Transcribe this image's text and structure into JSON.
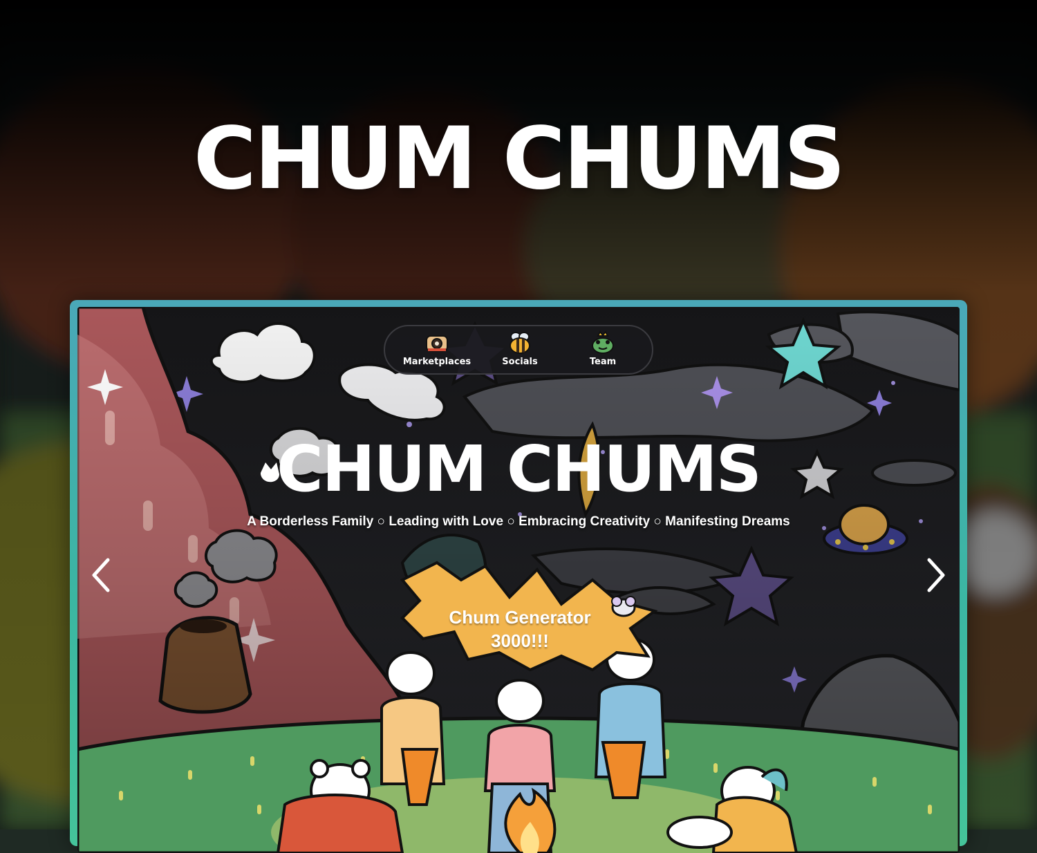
{
  "page": {
    "hero_title": "CHUM CHUMS"
  },
  "nav": {
    "items": [
      {
        "label": "Marketplaces",
        "icon": "camera-critter-icon"
      },
      {
        "label": "Socials",
        "icon": "bee-icon"
      },
      {
        "label": "Team",
        "icon": "frog-king-icon"
      }
    ]
  },
  "screen": {
    "title": "CHUM CHUMS",
    "tagline": "A Borderless Family ○ Leading with Love ○ Embracing Creativity ○ Manifesting Dreams",
    "badge_line1": "Chum Generator",
    "badge_line2": "3000!!!"
  },
  "colors": {
    "frame": "#3bb6a2",
    "sky": "#1e1f23",
    "grass": "#4f9a5f",
    "badge": "#f2b54e"
  }
}
